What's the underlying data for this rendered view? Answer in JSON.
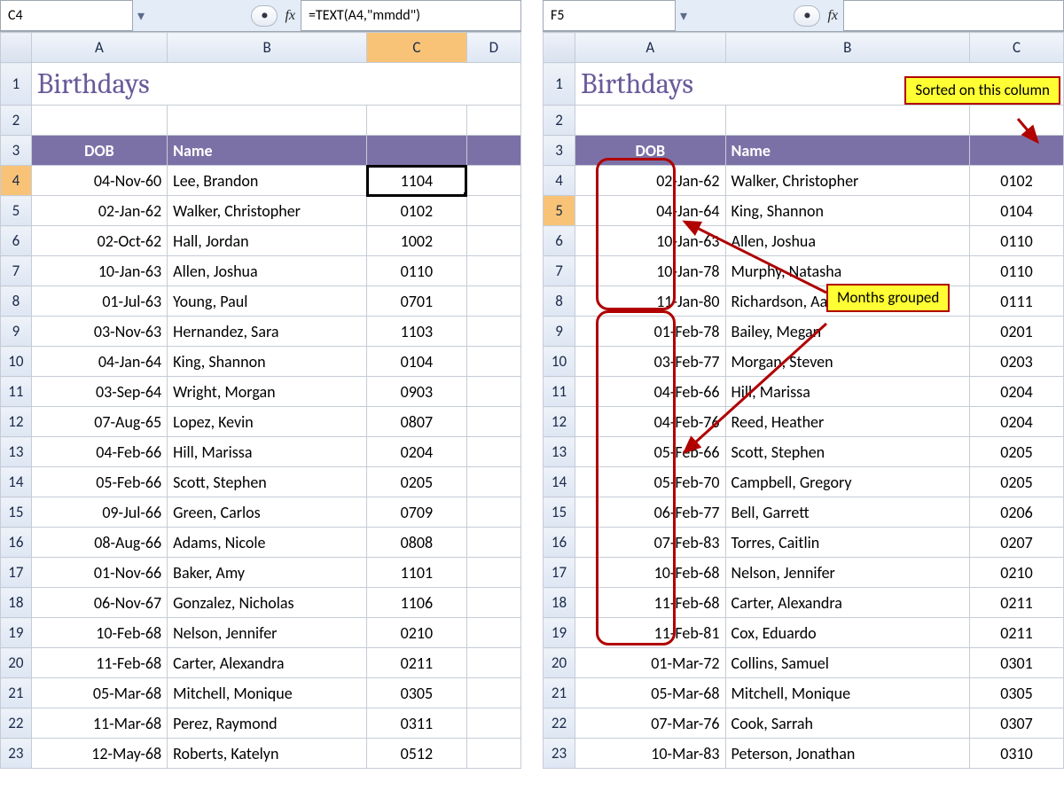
{
  "left": {
    "namebox": "C4",
    "formula": "=TEXT(A4,\"mmdd\")",
    "col_active": "C",
    "row_active": "4",
    "cols": [
      "A",
      "B",
      "C",
      "D"
    ],
    "title": "Birthdays",
    "header": {
      "dob": "DOB",
      "name": "Name"
    },
    "rows": [
      {
        "n": "4",
        "dob": "04-Nov-60",
        "name": "Lee, Brandon",
        "c": "1104",
        "sel": true
      },
      {
        "n": "5",
        "dob": "02-Jan-62",
        "name": "Walker, Christopher",
        "c": "0102"
      },
      {
        "n": "6",
        "dob": "02-Oct-62",
        "name": "Hall, Jordan",
        "c": "1002"
      },
      {
        "n": "7",
        "dob": "10-Jan-63",
        "name": "Allen, Joshua",
        "c": "0110"
      },
      {
        "n": "8",
        "dob": "01-Jul-63",
        "name": "Young, Paul",
        "c": "0701"
      },
      {
        "n": "9",
        "dob": "03-Nov-63",
        "name": "Hernandez, Sara",
        "c": "1103"
      },
      {
        "n": "10",
        "dob": "04-Jan-64",
        "name": "King, Shannon",
        "c": "0104"
      },
      {
        "n": "11",
        "dob": "03-Sep-64",
        "name": "Wright, Morgan",
        "c": "0903"
      },
      {
        "n": "12",
        "dob": "07-Aug-65",
        "name": "Lopez, Kevin",
        "c": "0807"
      },
      {
        "n": "13",
        "dob": "04-Feb-66",
        "name": "Hill, Marissa",
        "c": "0204"
      },
      {
        "n": "14",
        "dob": "05-Feb-66",
        "name": "Scott, Stephen",
        "c": "0205"
      },
      {
        "n": "15",
        "dob": "09-Jul-66",
        "name": "Green, Carlos",
        "c": "0709"
      },
      {
        "n": "16",
        "dob": "08-Aug-66",
        "name": "Adams, Nicole",
        "c": "0808"
      },
      {
        "n": "17",
        "dob": "01-Nov-66",
        "name": "Baker, Amy",
        "c": "1101"
      },
      {
        "n": "18",
        "dob": "06-Nov-67",
        "name": "Gonzalez, Nicholas",
        "c": "1106"
      },
      {
        "n": "19",
        "dob": "10-Feb-68",
        "name": "Nelson, Jennifer",
        "c": "0210"
      },
      {
        "n": "20",
        "dob": "11-Feb-68",
        "name": "Carter, Alexandra",
        "c": "0211"
      },
      {
        "n": "21",
        "dob": "05-Mar-68",
        "name": "Mitchell, Monique",
        "c": "0305"
      },
      {
        "n": "22",
        "dob": "11-Mar-68",
        "name": "Perez, Raymond",
        "c": "0311"
      },
      {
        "n": "23",
        "dob": "12-May-68",
        "name": "Roberts, Katelyn",
        "c": "0512"
      }
    ]
  },
  "right": {
    "namebox": "F5",
    "formula": "",
    "col_active": "",
    "row_active": "5",
    "cols": [
      "A",
      "B",
      "C"
    ],
    "title": "Birthdays",
    "header": {
      "dob": "DOB",
      "name": "Name"
    },
    "rows": [
      {
        "n": "4",
        "dob": "02-Jan-62",
        "name": "Walker, Christopher",
        "c": "0102"
      },
      {
        "n": "5",
        "dob": "04-Jan-64",
        "name": "King, Shannon",
        "c": "0104",
        "rowact": true
      },
      {
        "n": "6",
        "dob": "10-Jan-63",
        "name": "Allen, Joshua",
        "c": "0110"
      },
      {
        "n": "7",
        "dob": "10-Jan-78",
        "name": "Murphy, Natasha",
        "c": "0110"
      },
      {
        "n": "8",
        "dob": "11-Jan-80",
        "name": "Richardson, Aaron",
        "c": "0111"
      },
      {
        "n": "9",
        "dob": "01-Feb-78",
        "name": "Bailey, Megan",
        "c": "0201"
      },
      {
        "n": "10",
        "dob": "03-Feb-77",
        "name": "Morgan, Steven",
        "c": "0203"
      },
      {
        "n": "11",
        "dob": "04-Feb-66",
        "name": "Hill, Marissa",
        "c": "0204"
      },
      {
        "n": "12",
        "dob": "04-Feb-76",
        "name": "Reed, Heather",
        "c": "0204"
      },
      {
        "n": "13",
        "dob": "05-Feb-66",
        "name": "Scott, Stephen",
        "c": "0205"
      },
      {
        "n": "14",
        "dob": "05-Feb-70",
        "name": "Campbell, Gregory",
        "c": "0205"
      },
      {
        "n": "15",
        "dob": "06-Feb-77",
        "name": "Bell, Garrett",
        "c": "0206"
      },
      {
        "n": "16",
        "dob": "07-Feb-83",
        "name": "Torres, Caitlin",
        "c": "0207"
      },
      {
        "n": "17",
        "dob": "10-Feb-68",
        "name": "Nelson, Jennifer",
        "c": "0210"
      },
      {
        "n": "18",
        "dob": "11-Feb-68",
        "name": "Carter, Alexandra",
        "c": "0211"
      },
      {
        "n": "19",
        "dob": "11-Feb-81",
        "name": "Cox, Eduardo",
        "c": "0211"
      },
      {
        "n": "20",
        "dob": "01-Mar-72",
        "name": "Collins, Samuel",
        "c": "0301"
      },
      {
        "n": "21",
        "dob": "05-Mar-68",
        "name": "Mitchell, Monique",
        "c": "0305"
      },
      {
        "n": "22",
        "dob": "07-Mar-76",
        "name": "Cook, Sarrah",
        "c": "0307"
      },
      {
        "n": "23",
        "dob": "10-Mar-83",
        "name": "Peterson, Jonathan",
        "c": "0310"
      }
    ],
    "callout_sorted": "Sorted on this column",
    "callout_grouped": "Months grouped"
  },
  "fx_label": "fx"
}
